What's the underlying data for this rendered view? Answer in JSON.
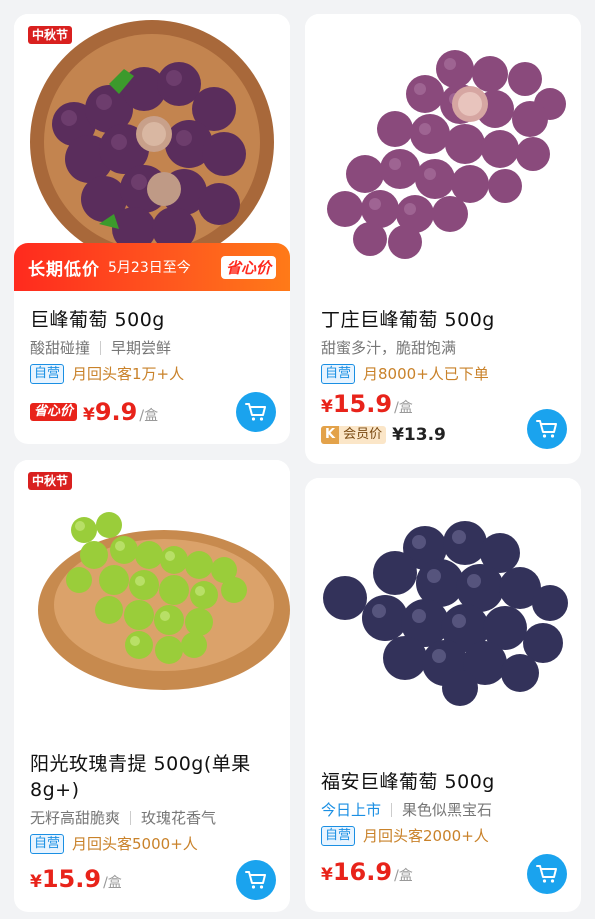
{
  "festival_tag": "中秋节",
  "products": [
    {
      "name": "巨峰葡萄 500g",
      "features": [
        "酸甜碰撞",
        "早期尝鲜"
      ],
      "badge": "自营",
      "repeat": "月回头客1万+人",
      "promo": {
        "main": "长期低价",
        "date": "5月23日至今",
        "tag": "省心价"
      },
      "price_prefix_badge": "省心价",
      "currency": "¥",
      "price": "9.9",
      "unit": "/盒"
    },
    {
      "name": "丁庄巨峰葡萄 500g",
      "features": [
        "甜蜜多汁，脆甜饱满"
      ],
      "badge": "自营",
      "repeat": "月8000+人已下单",
      "currency": "¥",
      "price": "15.9",
      "unit": "/盒",
      "member": {
        "icon": "K",
        "label": "会员价",
        "price": "¥13.9"
      }
    },
    {
      "name": "阳光玫瑰青提 500g(单果8g+)",
      "features": [
        "无籽高甜脆爽",
        "玫瑰花香气"
      ],
      "badge": "自营",
      "repeat": "月回头客5000+人",
      "currency": "¥",
      "price": "15.9",
      "unit": "/盒"
    },
    {
      "name": "福安巨峰葡萄 500g",
      "features": [
        "今日上市",
        "果色似黑宝石"
      ],
      "badge": "自营",
      "repeat": "月回头客2000+人",
      "currency": "¥",
      "price": "16.9",
      "unit": "/盒"
    }
  ],
  "icons": {
    "cart": "cart-icon"
  },
  "colors": {
    "price": "#e8231a",
    "accent": "#1aa3ee",
    "promo": "#ff3a1e"
  }
}
